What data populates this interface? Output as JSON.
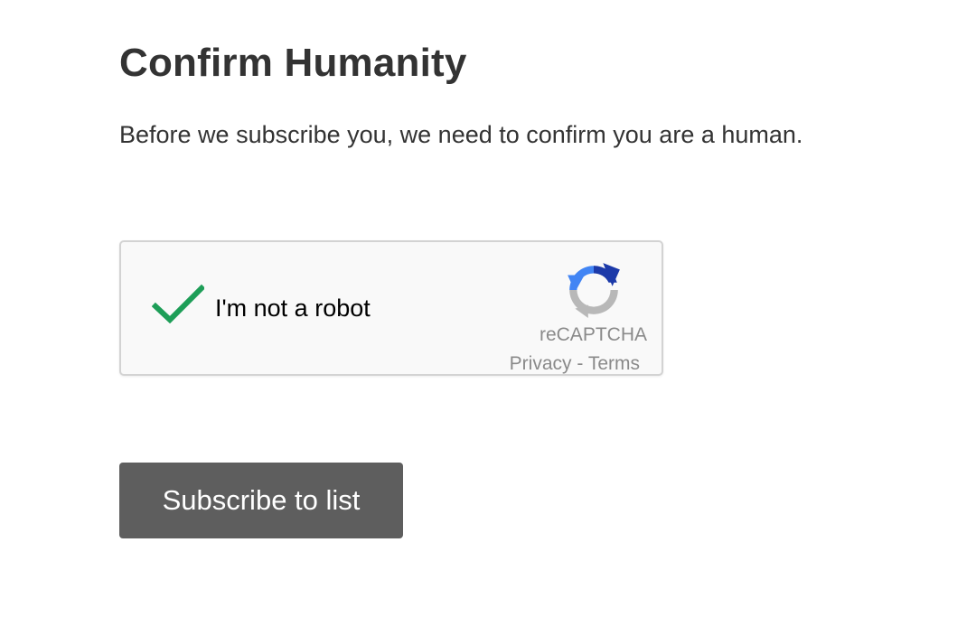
{
  "page": {
    "title": "Confirm Humanity",
    "intro": "Before we subscribe you, we need to confirm you are a human."
  },
  "captcha": {
    "checkbox_label": "I'm not a robot",
    "checked": true,
    "check_icon": "checkmark-icon",
    "check_color": "#1e9e58",
    "logo_icon": "recaptcha-logo-icon",
    "brand": "reCAPTCHA",
    "privacy_link": "Privacy",
    "separator": " - ",
    "terms_link": "Terms"
  },
  "actions": {
    "subscribe_label": "Subscribe to list",
    "subscribe_color": "#5e5e5e"
  }
}
